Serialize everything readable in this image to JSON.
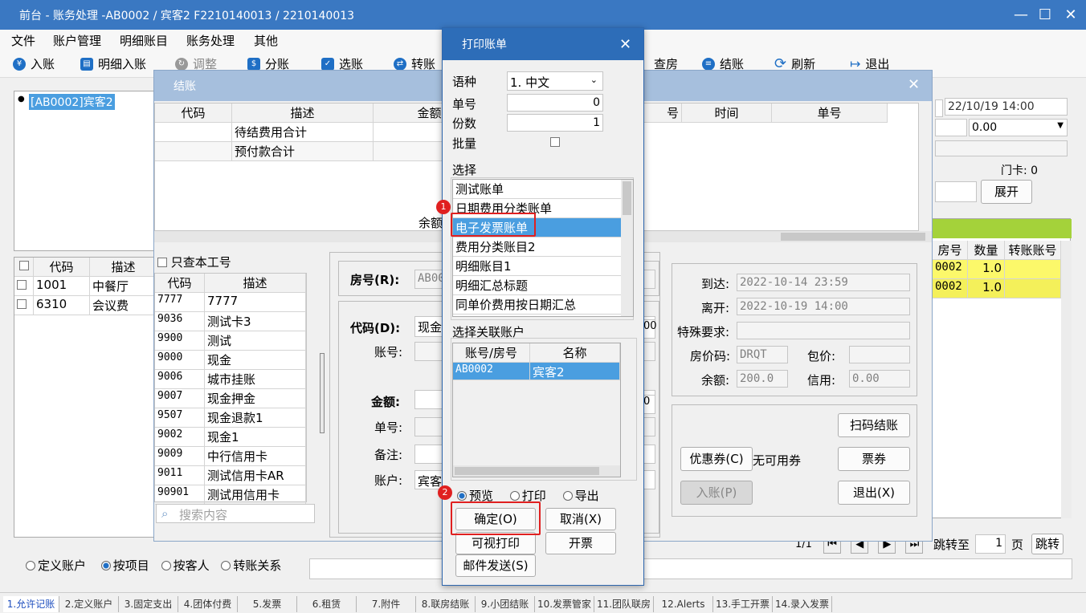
{
  "window": {
    "title": "前台 - 账务处理 -AB0002 / 宾客2 F2210140013 / 2210140013"
  },
  "menu": [
    "文件",
    "账户管理",
    "明细账目",
    "账务处理",
    "其他"
  ],
  "toolbar": {
    "ruzhang": "入账",
    "mingxi": "明细入账",
    "tiaozheng": "调整",
    "fenzhang": "分账",
    "xuanzhang": "选账",
    "zhuan": "转账",
    "chafang": "查房",
    "jiezhang": "结账",
    "shuaxin": "刷新",
    "tuichu": "退出"
  },
  "left": {
    "tree_item": "[AB0002]宾客2",
    "cols": [
      "代码",
      "描述"
    ],
    "rows": [
      [
        "1001",
        "中餐厅"
      ],
      [
        "6310",
        "会议费"
      ]
    ],
    "modes": [
      "定义账户",
      "按项目",
      "按客人",
      "转账关系"
    ]
  },
  "checkout": {
    "title": "结账",
    "cols": [
      "代码",
      "描述",
      "金额",
      "号",
      "时间",
      "单号"
    ],
    "rows": [
      "待结费用合计",
      "预付款合计"
    ],
    "balance_label": "余额",
    "only_mine": "只查本工号",
    "code_cols": [
      "代码",
      "描述"
    ],
    "codes": [
      [
        "7777",
        "7777"
      ],
      [
        "9036",
        "测试卡3"
      ],
      [
        "9900",
        "测试"
      ],
      [
        "9000",
        "现金"
      ],
      [
        "9006",
        "城市挂账"
      ],
      [
        "9007",
        "现金押金"
      ],
      [
        "9507",
        "现金退款1"
      ],
      [
        "9002",
        "现金1"
      ],
      [
        "9009",
        "中行信用卡"
      ],
      [
        "9011",
        "测试信用卡AR"
      ],
      [
        "90901",
        "测试用信用卡"
      ]
    ],
    "search_placeholder": "搜索内容",
    "room_label": "房号(R):",
    "room_value": "AB00",
    "code_label": "代码(D):",
    "code_value": "现金",
    "account_label": "账号:",
    "amount_label": "金额:",
    "amount_value": "0",
    "bill_label": "单号:",
    "remark_label": "备注:",
    "acct_label": "账户:",
    "acct_value": "宾客",
    "right_value": "00",
    "arrive_label": "到达:",
    "arrive": "2022-10-14 23:59",
    "leave_label": "离开:",
    "leave": "2022-10-19 14:00",
    "special_label": "特殊要求:",
    "rate_label": "房价码:",
    "rate": "DRQT",
    "package_label": "包价:",
    "bal_label": "余额:",
    "bal": "200.0",
    "credit_label": "信用:",
    "credit": "0.00",
    "scan_btn": "扫码结账",
    "coupon_btn": "优惠券(C)",
    "no_coupon": "无可用券",
    "ticket_btn": "票券",
    "post_btn": "入账(P)",
    "exit_btn": "退出(X)"
  },
  "right": {
    "date": "22/10/19 14:00",
    "amount": "0.00",
    "door_card": "门卡: 0",
    "expand": "展开",
    "cols": [
      "房号",
      "数量",
      "转账账号"
    ],
    "rows": [
      [
        "0002",
        "1.0",
        ""
      ],
      [
        "0002",
        "1.0",
        ""
      ]
    ],
    "pager": "1/1",
    "jump_to": "跳转至",
    "page_num": "1",
    "page_unit": "页",
    "jump_btn": "跳转"
  },
  "dialog": {
    "title": "打印账单",
    "lang_label": "语种",
    "lang_value": "1. 中文",
    "bill_label": "单号",
    "bill_value": "0",
    "copies_label": "份数",
    "copies_value": "1",
    "batch_label": "批量",
    "select_label": "选择",
    "items": [
      "测试账单",
      "日期费用分类账单",
      "电子发票账单",
      "费用分类账目2",
      "明细账目1",
      "明细汇总标题",
      "同单价费用按日期汇总",
      "明细明细账目"
    ],
    "selected_index": 2,
    "linked_label": "选择关联账户",
    "linked_cols": [
      "账号/房号",
      "名称"
    ],
    "linked_rows": [
      [
        "AB0002",
        "宾客2"
      ]
    ],
    "modes": [
      "预览",
      "打印",
      "导出"
    ],
    "ok_btn": "确定(O)",
    "cancel_btn": "取消(X)",
    "visual_btn": "可视打印",
    "invoice_btn": "开票",
    "email_btn": "邮件发送(S)",
    "badge1": "1",
    "badge2": "2"
  },
  "statusbar": [
    "1.允许记账",
    "2.定义账户",
    "3.固定支出",
    "4.团体付费",
    "5.发票",
    "6.租赁",
    "7.附件",
    "8.联房结账",
    "9.小团结账",
    "10.发票管家",
    "11.团队联房",
    "12.Alerts",
    "13.手工开票",
    "14.录入发票"
  ],
  "colors": {
    "accent": "#3a78c2",
    "selected": "#4a9ee0",
    "yellow": "#fcf86a",
    "green": "#a4d23a",
    "red": "#e02020"
  }
}
